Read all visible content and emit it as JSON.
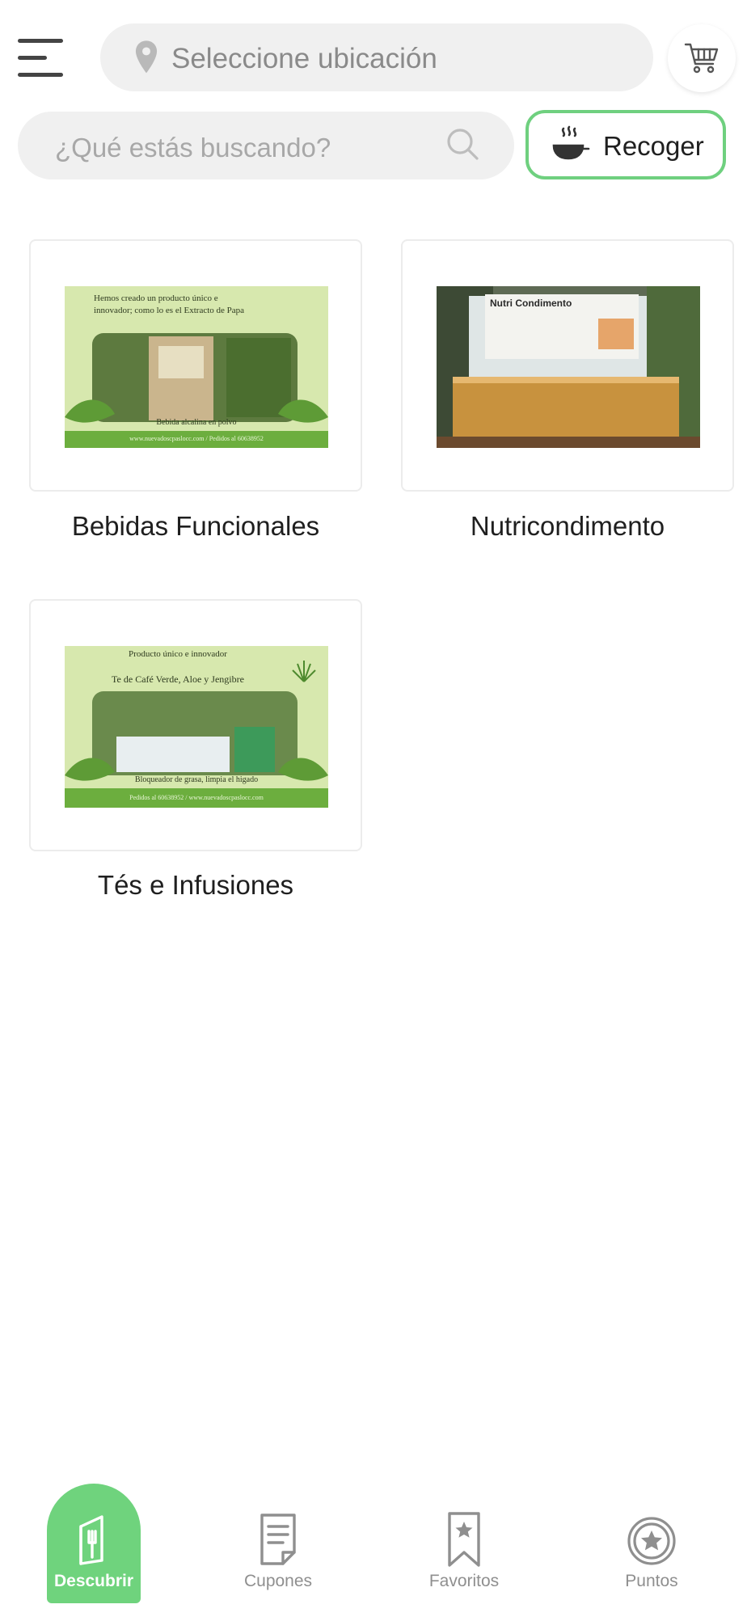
{
  "header": {
    "menu_icon": "hamburger-menu-icon",
    "location_placeholder": "Seleccione ubicación",
    "location_icon": "map-pin-icon",
    "cart_icon": "shopping-cart-icon"
  },
  "search": {
    "placeholder": "¿Qué estás buscando?",
    "icon": "search-icon"
  },
  "pickup": {
    "label": "Recoger",
    "icon": "pan-steam-icon"
  },
  "categories": [
    {
      "label": "Bebidas Funcionales",
      "image_text": [
        "Hemos creado un producto único e",
        "innovador; como lo es el Extracto de Papa",
        "Bebida alcalina en polvo",
        "www.nuevadoscpaslocc.com / Pedidos al 60638952"
      ]
    },
    {
      "label": "Nutricondimento",
      "image_text": [
        "Nutri Condimento"
      ]
    },
    {
      "label": "Tés e Infusiones",
      "image_text": [
        "Producto único e innovador",
        "Te de Café Verde, Aloe y Jengibre",
        "Bloqueador de grasa, limpia el higado",
        "Pedidos al 60638952 / www.nuevadoscpaslocc.com"
      ]
    }
  ],
  "colors": {
    "accent": "#6fd37d",
    "input_bg": "#f0f0f0",
    "placeholder": "#a8a8a8"
  },
  "bottom_nav": [
    {
      "label": "Descubrir",
      "icon": "menu-book-utensils-icon",
      "active": true
    },
    {
      "label": "Cupones",
      "icon": "coupon-document-icon",
      "active": false
    },
    {
      "label": "Favoritos",
      "icon": "bookmark-star-icon",
      "active": false
    },
    {
      "label": "Puntos",
      "icon": "star-circle-icon",
      "active": false
    }
  ]
}
